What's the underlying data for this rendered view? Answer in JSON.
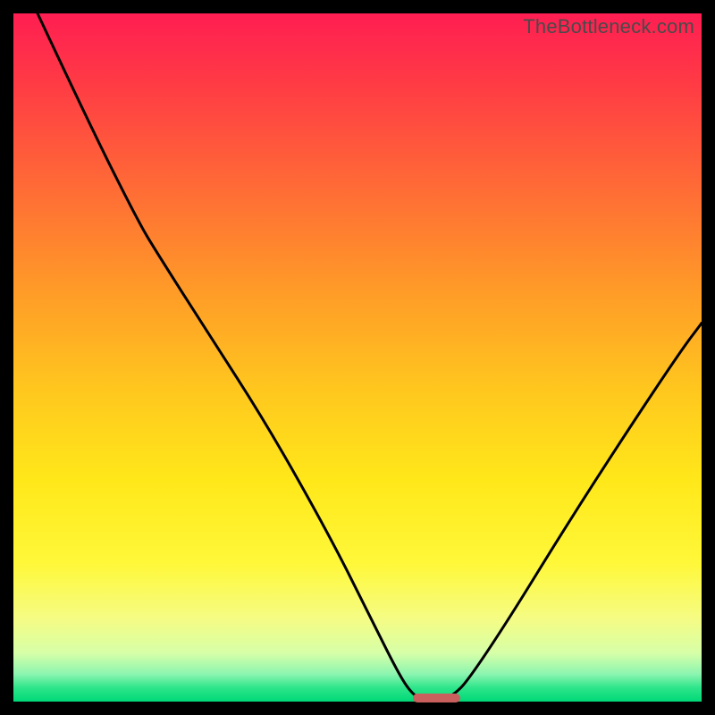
{
  "watermark": "TheBottleneck.com",
  "chart_data": {
    "type": "line",
    "title": "",
    "xlabel": "",
    "ylabel": "",
    "xlim": [
      0,
      100
    ],
    "ylim": [
      0,
      100
    ],
    "series": [
      {
        "name": "curve",
        "color": "#000000",
        "points": [
          {
            "x": 3.5,
            "y": 100
          },
          {
            "x": 11,
            "y": 84
          },
          {
            "x": 18,
            "y": 70
          },
          {
            "x": 21,
            "y": 65
          },
          {
            "x": 28,
            "y": 54
          },
          {
            "x": 37,
            "y": 40
          },
          {
            "x": 46,
            "y": 24
          },
          {
            "x": 52,
            "y": 12
          },
          {
            "x": 56,
            "y": 4
          },
          {
            "x": 58,
            "y": 1
          },
          {
            "x": 60,
            "y": 0
          },
          {
            "x": 62,
            "y": 0
          },
          {
            "x": 64,
            "y": 1
          },
          {
            "x": 66,
            "y": 3
          },
          {
            "x": 72,
            "y": 12
          },
          {
            "x": 80,
            "y": 25
          },
          {
            "x": 89,
            "y": 39
          },
          {
            "x": 97,
            "y": 51
          },
          {
            "x": 100,
            "y": 55
          }
        ]
      }
    ],
    "marker": {
      "name": "optimal-region",
      "color": "#c9605e",
      "x_start": 58,
      "x_end": 65,
      "y": 0.5
    },
    "background_gradient": {
      "top": "#ff1e52",
      "middle": "#ffe81a",
      "bottom": "#00d877"
    }
  }
}
